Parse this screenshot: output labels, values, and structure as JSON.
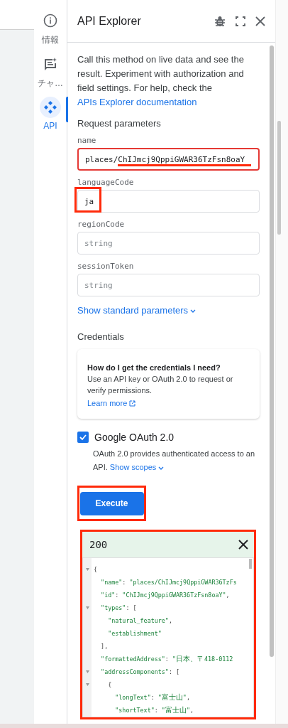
{
  "rail": [
    {
      "kind": "info",
      "label": "情報",
      "selected": false
    },
    {
      "kind": "chat",
      "label": "チャ…",
      "selected": false
    },
    {
      "kind": "api",
      "label": "API",
      "selected": true
    }
  ],
  "panel": {
    "title": "API Explorer",
    "intro": "Call this method on live data and see the result. Experiment with authorization and field settings. For help, check the ",
    "intro_link": "APIs Explorer documentation",
    "section_title": "Request parameters",
    "params": [
      {
        "label": "name",
        "value": "places/ChIJmcj9QppiGWAR36TzFsn8oaY",
        "highlighted": true
      },
      {
        "label": "languageCode",
        "value": "ja",
        "highlighted": true
      },
      {
        "label": "regionCode",
        "placeholder": "string",
        "highlighted": false
      },
      {
        "label": "sessionToken",
        "placeholder": "string",
        "highlighted": false
      }
    ],
    "show_standard": "Show standard parameters",
    "credentials_title": "Credentials",
    "help_card": {
      "question": "How do I get the credentials I need?",
      "body": "Use an API key or OAuth 2.0 to request or verify permissions.",
      "link": "Learn more"
    },
    "oauth": {
      "label": "Google OAuth 2.0",
      "checked": true,
      "description": "OAuth 2.0 provides authenticated access to an API.",
      "scopes_link": "Show scopes"
    },
    "execute": "Execute",
    "response": {
      "status": "200",
      "lines": [
        {
          "text": "{",
          "fold": true
        },
        {
          "text": "  \"name\": \"places/ChIJmcj9QppiGWAR36TzFs",
          "fold": false
        },
        {
          "text": "  \"id\": \"ChIJmcj9QppiGWAR36TzFsn8oaY\",",
          "fold": false
        },
        {
          "text": "  \"types\": [",
          "fold": true
        },
        {
          "text": "    \"natural_feature\",",
          "fold": false
        },
        {
          "text": "    \"establishment\"",
          "fold": false
        },
        {
          "text": "  ],",
          "fold": false
        },
        {
          "text": "  \"formattedAddress\": \"日本、〒418-0112",
          "fold": false
        },
        {
          "text": "  \"addressComponents\": [",
          "fold": true
        },
        {
          "text": "    {",
          "fold": true
        },
        {
          "text": "      \"longText\": \"富士山\",",
          "fold": false
        },
        {
          "text": "      \"shortText\": \"富士山\",",
          "fold": false
        }
      ]
    }
  }
}
